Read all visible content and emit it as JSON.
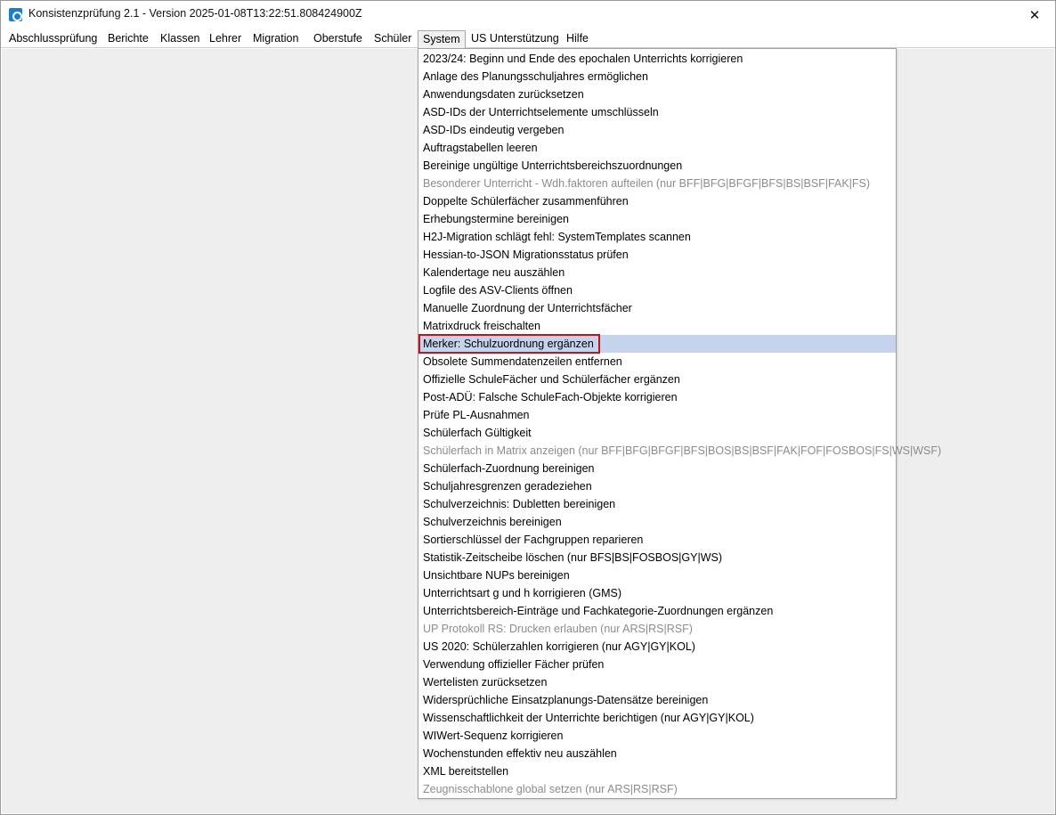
{
  "window": {
    "title": "Konsistenzprüfung 2.1 - Version 2025-01-08T13:22:51.808424900Z",
    "close_glyph": "✕"
  },
  "menubar": [
    {
      "label": "Abschlussprüfung"
    },
    {
      "label": "Berichte"
    },
    {
      "label": "Klassen"
    },
    {
      "label": "Lehrer"
    },
    {
      "label": "Migration"
    },
    {
      "label": "Oberstufe"
    },
    {
      "label": "Schüler"
    },
    {
      "label": "System",
      "open": true
    },
    {
      "label": "US Unterstützung"
    },
    {
      "label": "Hilfe"
    }
  ],
  "system_menu": {
    "items": [
      {
        "label": "2023/24: Beginn und Ende des epochalen Unterrichts korrigieren",
        "enabled": true
      },
      {
        "label": "Anlage des Planungsschuljahres ermöglichen",
        "enabled": true
      },
      {
        "label": "Anwendungsdaten zurücksetzen",
        "enabled": true
      },
      {
        "label": "ASD-IDs der Unterrichtselemente umschlüsseln",
        "enabled": true
      },
      {
        "label": "ASD-IDs eindeutig vergeben",
        "enabled": true
      },
      {
        "label": "Auftragstabellen leeren",
        "enabled": true
      },
      {
        "label": "Bereinige ungültige Unterrichtsbereichszuordnungen",
        "enabled": true
      },
      {
        "label": "Besonderer Unterricht - Wdh.faktoren aufteilen (nur BFF|BFG|BFGF|BFS|BS|BSF|FAK|FS)",
        "enabled": false
      },
      {
        "label": "Doppelte Schülerfächer zusammenführen",
        "enabled": true
      },
      {
        "label": "Erhebungstermine bereinigen",
        "enabled": true
      },
      {
        "label": "H2J-Migration schlägt fehl: SystemTemplates scannen",
        "enabled": true
      },
      {
        "label": "Hessian-to-JSON Migrationsstatus prüfen",
        "enabled": true
      },
      {
        "label": "Kalendertage neu auszählen",
        "enabled": true
      },
      {
        "label": "Logfile des ASV-Clients öffnen",
        "enabled": true
      },
      {
        "label": "Manuelle Zuordnung der Unterrichtsfächer",
        "enabled": true
      },
      {
        "label": "Matrixdruck freischalten",
        "enabled": true
      },
      {
        "label": "Merker: Schulzuordnung ergänzen",
        "enabled": true,
        "highlighted": true
      },
      {
        "label": "Obsolete Summendatenzeilen entfernen",
        "enabled": true
      },
      {
        "label": "Offizielle SchuleFächer und Schülerfächer ergänzen",
        "enabled": true
      },
      {
        "label": "Post-ADÜ: Falsche SchuleFach-Objekte korrigieren",
        "enabled": true
      },
      {
        "label": "Prüfe PL-Ausnahmen",
        "enabled": true
      },
      {
        "label": "Schülerfach Gültigkeit",
        "enabled": true
      },
      {
        "label": "Schülerfach in Matrix anzeigen (nur BFF|BFG|BFGF|BFS|BOS|BS|BSF|FAK|FOF|FOSBOS|FS|WS|WSF)",
        "enabled": false
      },
      {
        "label": "Schülerfach-Zuordnung bereinigen",
        "enabled": true
      },
      {
        "label": "Schuljahresgrenzen geradeziehen",
        "enabled": true
      },
      {
        "label": "Schulverzeichnis: Dubletten bereinigen",
        "enabled": true
      },
      {
        "label": "Schulverzeichnis bereinigen",
        "enabled": true
      },
      {
        "label": "Sortierschlüssel der Fachgruppen reparieren",
        "enabled": true
      },
      {
        "label": "Statistik-Zeitscheibe löschen (nur BFS|BS|FOSBOS|GY|WS)",
        "enabled": true
      },
      {
        "label": "Unsichtbare NUPs bereinigen",
        "enabled": true
      },
      {
        "label": "Unterrichtsart g und h korrigieren (GMS)",
        "enabled": true
      },
      {
        "label": "Unterrichtsbereich-Einträge und Fachkategorie-Zuordnungen ergänzen",
        "enabled": true
      },
      {
        "label": "UP Protokoll RS: Drucken erlauben (nur ARS|RS|RSF)",
        "enabled": false
      },
      {
        "label": "US 2020: Schülerzahlen korrigieren (nur AGY|GY|KOL)",
        "enabled": true
      },
      {
        "label": "Verwendung offizieller Fächer prüfen",
        "enabled": true
      },
      {
        "label": "Wertelisten zurücksetzen",
        "enabled": true
      },
      {
        "label": "Widersprüchliche Einsatzplanungs-Datensätze bereinigen",
        "enabled": true
      },
      {
        "label": "Wissenschaftlichkeit der Unterrichte berichtigen (nur AGY|GY|KOL)",
        "enabled": true
      },
      {
        "label": "WIWert-Sequenz korrigieren",
        "enabled": true
      },
      {
        "label": "Wochenstunden effektiv neu auszählen",
        "enabled": true
      },
      {
        "label": "XML bereitstellen",
        "enabled": true
      },
      {
        "label": "Zeugnisschablone global setzen (nur ARS|RS|RSF)",
        "enabled": false
      }
    ]
  },
  "colors": {
    "highlight": "#c5d4ec",
    "focus_border": "#c4141b",
    "disabled_text": "#8c8c8c",
    "client_bg": "#eeeeee"
  }
}
